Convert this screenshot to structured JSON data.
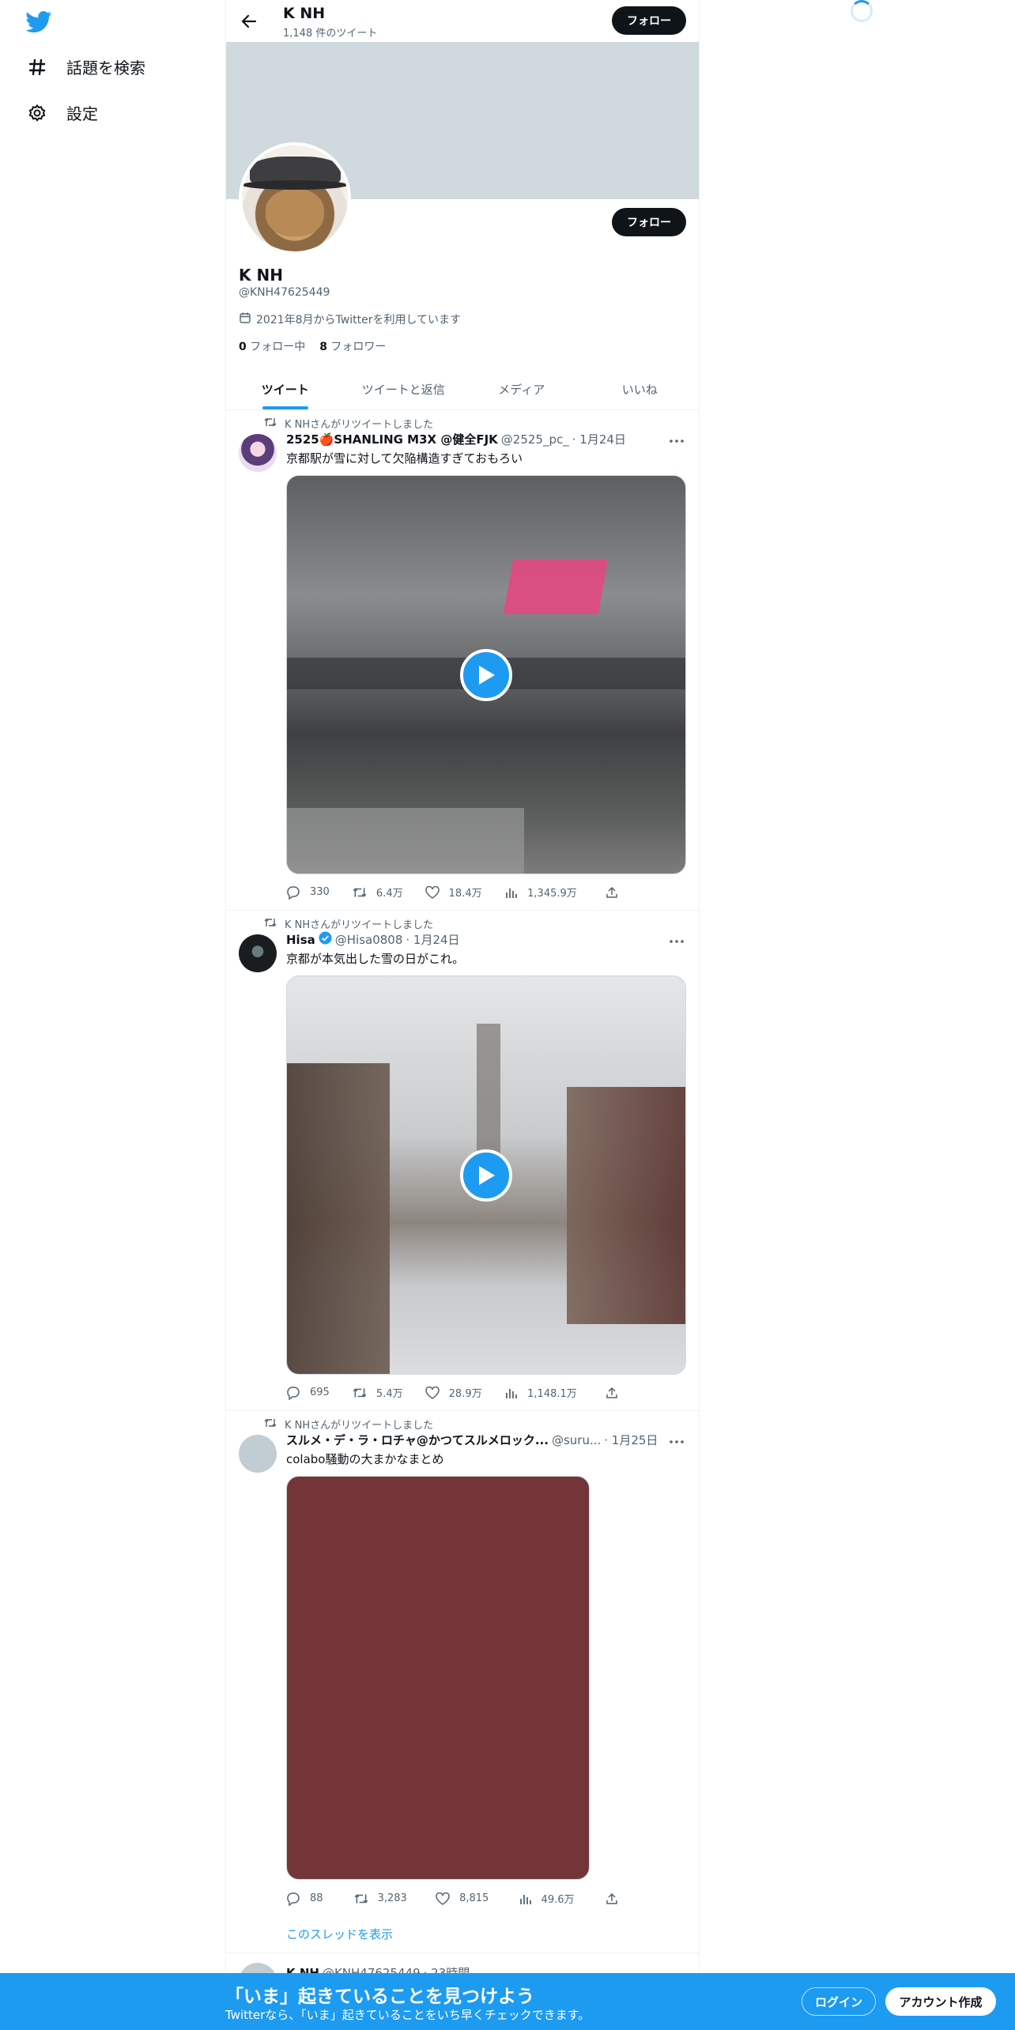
{
  "nav": {
    "items": [
      {
        "label": "話題を検索",
        "icon": "hashtag-icon"
      },
      {
        "label": "設定",
        "icon": "gear-icon"
      }
    ]
  },
  "profile": {
    "header_name": "K NH",
    "tweet_count": "1,148 件のツイート",
    "follow_label": "フォロー",
    "name": "K NH",
    "handle": "@KNH47625449",
    "joined": "2021年8月からTwitterを利用しています",
    "following_count": "0",
    "following_label": "フォロー中",
    "followers_count": "8",
    "followers_label": "フォロワー"
  },
  "tabs": [
    "ツイート",
    "ツイートと返信",
    "メディア",
    "いいね"
  ],
  "tweets": [
    {
      "retweet_label": "K NHさんがリツイートしました",
      "name": "2525🍎SHANLING M3X @健全FJK",
      "handle": "@2525_pc_",
      "date": "· 1月24日",
      "text": "京都駅が雪に対して欠陥構造すぎておもろい",
      "replies": "330",
      "retweets": "6.4万",
      "likes": "18.4万",
      "views": "1,345.9万"
    },
    {
      "retweet_label": "K NHさんがリツイートしました",
      "name": "Hisa",
      "handle": "@Hisa0808",
      "date": "· 1月24日",
      "text": "京都が本気出した雪の日がこれ。",
      "replies": "695",
      "retweets": "5.4万",
      "likes": "28.9万",
      "views": "1,148.1万"
    },
    {
      "retweet_label": "K NHさんがリツイートしました",
      "name": "スルメ・デ・ラ・ロチャ@かつてスルメロック...",
      "handle": "@suru...",
      "date": "· 1月25日",
      "text": "colabo騒動の大まかなまとめ",
      "replies": "88",
      "retweets": "3,283",
      "likes": "8,815",
      "views": "49.6万",
      "thread_link": "このスレッドを表示"
    },
    {
      "name": "K NH",
      "handle": "@KNH47625449",
      "date": "· 23時間"
    }
  ],
  "bottom_bar": {
    "title": "「いま」起きていることを見つけよう",
    "subtitle": "Twitterなら、「いま」起きていることをいち早くチェックできます。",
    "login": "ログイン",
    "signup": "アカウント作成"
  },
  "colors": {
    "accent": "#1d9bf0",
    "banner": "#cfd9de",
    "media3": "#733537"
  }
}
